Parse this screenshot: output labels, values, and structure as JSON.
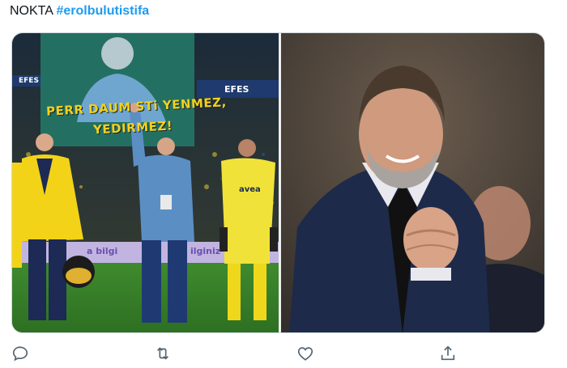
{
  "tweet": {
    "text": "NOKTA ",
    "hashtag": "#erolbulutistifa"
  },
  "photo_left": {
    "banner_line1": "PERR DAUM  ",
    "banner_line1b": "STi YENMEZ,",
    "banner_line2": "YEDIRMEZ!",
    "sponsor_top_left": "EFES",
    "sponsor_top_right": "EFES",
    "jersey_sponsor": "avea",
    "ad_board_left": "a bilgi",
    "ad_board_right": "ilginiz"
  },
  "actions": {
    "reply_icon": "reply-icon",
    "retweet_icon": "retweet-icon",
    "like_icon": "like-icon",
    "share_icon": "share-icon"
  },
  "colors": {
    "hashtag": "#1d9bf0",
    "icon": "#536471"
  }
}
